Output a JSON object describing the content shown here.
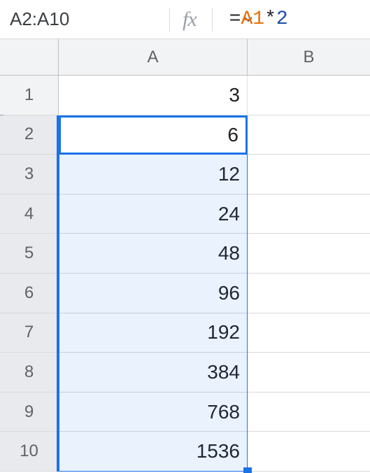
{
  "formula_bar": {
    "name_box": "A2:A10",
    "fx_label": "fx",
    "formula": {
      "eq": "=",
      "ref": "A1",
      "op": "*",
      "num": "2"
    }
  },
  "columns": {
    "a": "A",
    "b": "B"
  },
  "rows": [
    {
      "n": "1",
      "a": "3",
      "b": ""
    },
    {
      "n": "2",
      "a": "6",
      "b": ""
    },
    {
      "n": "3",
      "a": "12",
      "b": ""
    },
    {
      "n": "4",
      "a": "24",
      "b": ""
    },
    {
      "n": "5",
      "a": "48",
      "b": ""
    },
    {
      "n": "6",
      "a": "96",
      "b": ""
    },
    {
      "n": "7",
      "a": "192",
      "b": ""
    },
    {
      "n": "8",
      "a": "384",
      "b": ""
    },
    {
      "n": "9",
      "a": "768",
      "b": ""
    },
    {
      "n": "10",
      "a": "1536",
      "b": ""
    }
  ],
  "active_cell_value": "6"
}
